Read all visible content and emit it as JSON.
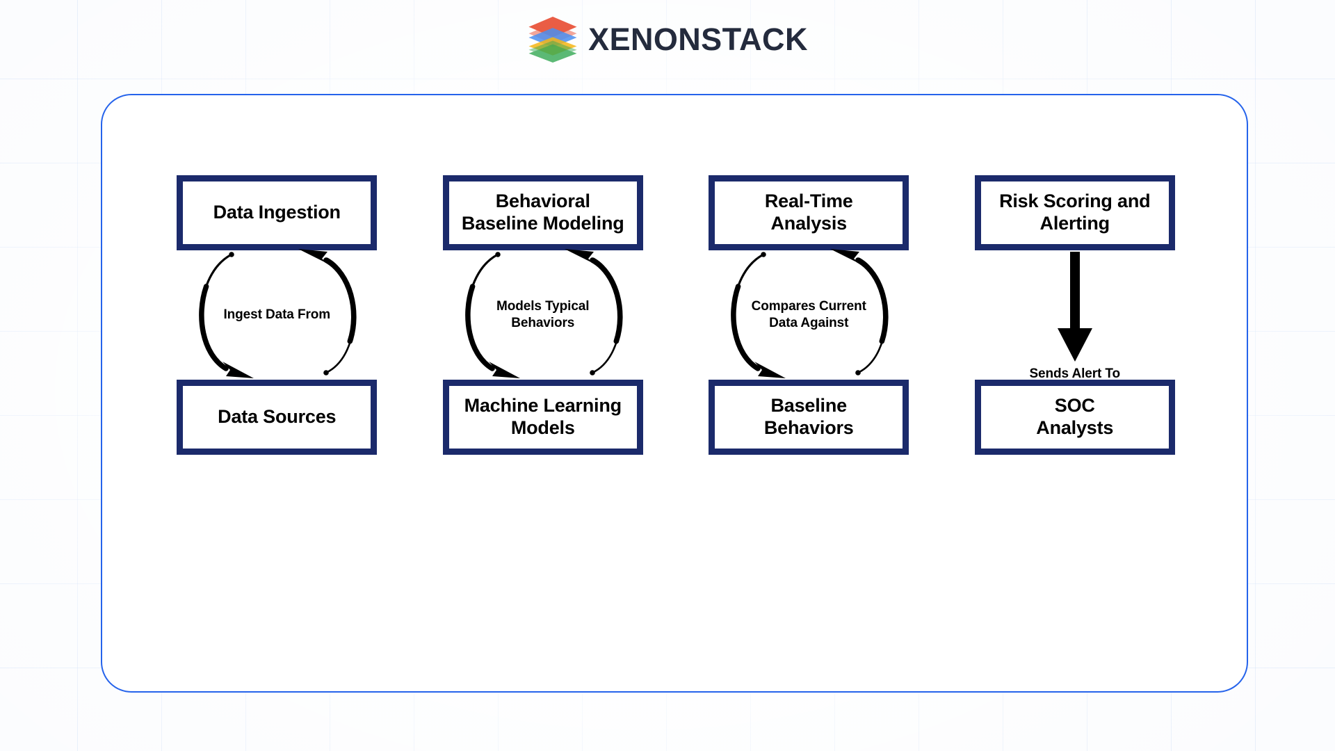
{
  "brand": {
    "name": "XENONSTACK",
    "logo_icon": "stacked-layers-logo",
    "logo_colors": [
      "#e8472c",
      "#4a8ef0",
      "#f5b516",
      "#34a853"
    ],
    "text_color": "#242b3d"
  },
  "card": {
    "border_color": "#2563eb",
    "background": "#ffffff"
  },
  "theme": {
    "box_border_color": "#1b2a6b",
    "arrow_color": "#000000",
    "grid_line_color": "#bfd6f5",
    "page_background": "#fbfcfe"
  },
  "diagram": {
    "type": "flow-cycle-diagram",
    "columns": [
      {
        "id": "data-ingestion",
        "top_box": "Data Ingestion",
        "connector_type": "cycle",
        "connector_label": "Ingest Data From",
        "bottom_box": "Data Sources"
      },
      {
        "id": "behavioral-baseline-modeling",
        "top_box": "Behavioral\nBaseline Modeling",
        "top_box_line1": "Behavioral",
        "top_box_line2": "Baseline Modeling",
        "connector_type": "cycle",
        "connector_label": "Models Typical\nBehaviors",
        "connector_label_line1": "Models Typical",
        "connector_label_line2": "Behaviors",
        "bottom_box": "Machine Learning\nModels",
        "bottom_box_line1": "Machine Learning",
        "bottom_box_line2": "Models"
      },
      {
        "id": "real-time-analysis",
        "top_box": "Real-Time\nAnalysis",
        "top_box_line1": "Real-Time",
        "top_box_line2": "Analysis",
        "connector_type": "cycle",
        "connector_label": "Compares Current\nData Against",
        "connector_label_line1": "Compares Current",
        "connector_label_line2": "Data Against",
        "bottom_box": "Baseline\nBehaviors",
        "bottom_box_line1": "Baseline",
        "bottom_box_line2": "Behaviors"
      },
      {
        "id": "risk-scoring-and-alerting",
        "top_box": "Risk Scoring and\nAlerting",
        "top_box_line1": "Risk Scoring and",
        "top_box_line2": "Alerting",
        "connector_type": "straight-arrow-down",
        "connector_label": "Sends Alert To",
        "bottom_box": "SOC\nAnalysts",
        "bottom_box_line1": "SOC",
        "bottom_box_line2": "Analysts"
      }
    ]
  }
}
